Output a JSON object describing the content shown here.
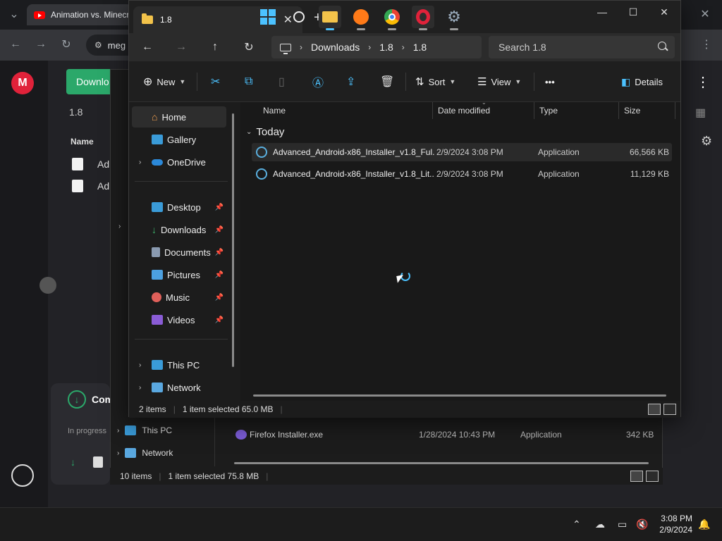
{
  "chrome": {
    "tab_title": "Animation vs. Minecr",
    "omnibox_text": "meg",
    "close_glyph": "✕"
  },
  "mega": {
    "logo_letter": "M",
    "download_label": "Downlo",
    "folder_name": "1.8",
    "name_header": "Name",
    "rows": [
      "Ad",
      "Ad"
    ],
    "transfer_label": "Com",
    "transfer_status": "In progress"
  },
  "back_explorer": {
    "nav": [
      {
        "label": "This PC"
      },
      {
        "label": "Network"
      }
    ],
    "file": {
      "name": "Firefox Installer.exe",
      "date": "1/28/2024 10:43 PM",
      "type": "Application",
      "size": "342 KB"
    },
    "status": {
      "items": "10 items",
      "selected": "1 item selected  75.8 MB"
    }
  },
  "explorer": {
    "tab_title": "1.8",
    "breadcrumb": [
      "Downloads",
      "1.8",
      "1.8"
    ],
    "search_placeholder": "Search 1.8",
    "toolbar": {
      "new": "New",
      "sort": "Sort",
      "view": "View",
      "more": "•••",
      "details": "Details"
    },
    "nav": {
      "home": "Home",
      "gallery": "Gallery",
      "onedrive": "OneDrive",
      "desktop": "Desktop",
      "downloads": "Downloads",
      "documents": "Documents",
      "pictures": "Pictures",
      "music": "Music",
      "videos": "Videos",
      "this_pc": "This PC",
      "network": "Network"
    },
    "columns": {
      "name": "Name",
      "date": "Date modified",
      "type": "Type",
      "size": "Size"
    },
    "group": "Today",
    "files": [
      {
        "name": "Advanced_Android-x86_Installer_v1.8_Ful...",
        "date": "2/9/2024 3:08 PM",
        "type": "Application",
        "size": "66,566 KB"
      },
      {
        "name": "Advanced_Android-x86_Installer_v1.8_Lit...",
        "date": "2/9/2024 3:08 PM",
        "type": "Application",
        "size": "11,129 KB"
      }
    ],
    "status": {
      "items": "2 items",
      "selected": "1 item selected  65.0 MB"
    }
  },
  "taskbar": {
    "time": "3:08 PM",
    "date": "2/9/2024"
  },
  "colors": {
    "accent": "#4cc2ff",
    "mega_red": "#e0223a",
    "mega_green": "#2ba86a",
    "folder": "#f3c34a"
  }
}
